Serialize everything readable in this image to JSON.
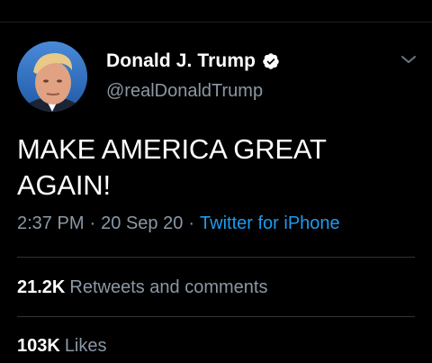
{
  "tweet": {
    "display_name": "Donald J. Trump",
    "handle": "@realDonaldTrump",
    "verified_icon": "verified-badge-icon",
    "menu_icon": "chevron-down-icon",
    "text_line1": "MAKE AMERICA GREAT",
    "text_line2": "AGAIN!",
    "time": "2:37 PM",
    "separator": "·",
    "date": "20 Sep 20",
    "source": "Twitter for iPhone"
  },
  "stats": {
    "retweets_count": "21.2K",
    "retweets_label": "Retweets and comments",
    "likes_count": "103K",
    "likes_label": "Likes"
  },
  "colors": {
    "background": "#000000",
    "primary_text": "#ffffff",
    "secondary_text": "#8b98a5",
    "link": "#1d9bf0",
    "divider": "#2f3336"
  }
}
